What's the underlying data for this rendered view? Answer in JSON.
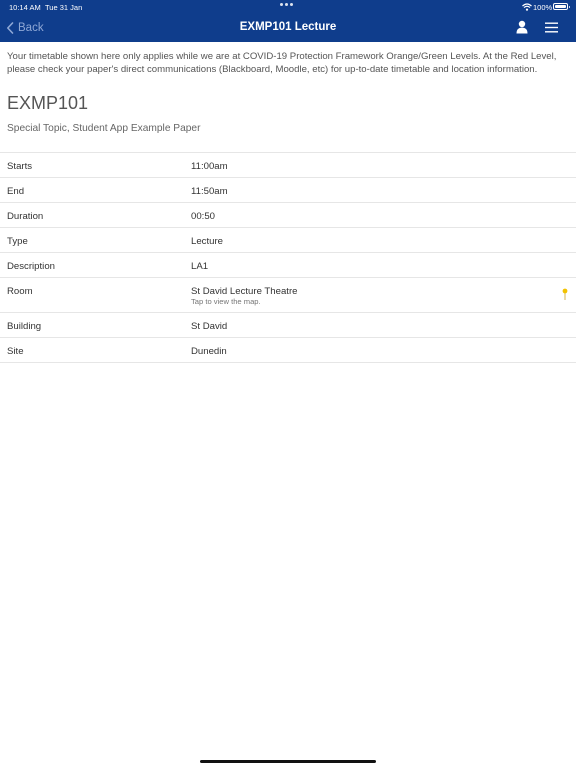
{
  "status_bar": {
    "time": "10:14 AM",
    "date": "Tue 31 Jan",
    "battery": "100%"
  },
  "nav": {
    "back_label": "Back",
    "title": "EXMP101 Lecture",
    "icons": [
      "user-icon",
      "menu-icon"
    ]
  },
  "notice": "Your timetable shown here only applies while we are at COVID-19 Protection Framework Orange/Green Levels. At the Red Level, please check your paper's direct communications (Blackboard, Moodle, etc) for up-to-date timetable and location information.",
  "paper": {
    "code": "EXMP101",
    "name": "Special Topic, Student App Example Paper"
  },
  "details": [
    {
      "label": "Starts",
      "value": "11:00am"
    },
    {
      "label": "End",
      "value": "11:50am"
    },
    {
      "label": "Duration",
      "value": "00:50"
    },
    {
      "label": "Type",
      "value": "Lecture"
    },
    {
      "label": "Description",
      "value": "LA1"
    },
    {
      "label": "Room",
      "value": "St David Lecture Theatre",
      "sub": "Tap to view the map."
    },
    {
      "label": "Building",
      "value": "St David"
    },
    {
      "label": "Site",
      "value": "Dunedin"
    }
  ],
  "colors": {
    "header_bg": "#0f3d8c",
    "back_text": "#8fa8d6",
    "map_pin": "#f2c200"
  }
}
